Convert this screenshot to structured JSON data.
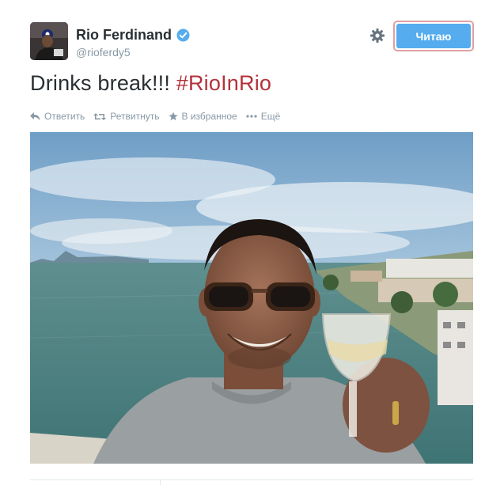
{
  "user": {
    "display_name": "Rio Ferdinand",
    "handle": "@rioferdy5",
    "verified": true
  },
  "follow_button": {
    "label": "Читаю"
  },
  "tweet": {
    "text": "Drinks break!!!",
    "hashtag": "#RioInRio"
  },
  "actions": [
    {
      "label": "Ответить",
      "icon": "reply-icon"
    },
    {
      "label": "Ретвитнуть",
      "icon": "retweet-icon"
    },
    {
      "label": "В избранное",
      "icon": "star-icon"
    },
    {
      "label": "Ещё",
      "icon": "more-icon"
    }
  ],
  "colors": {
    "accent": "#55acee",
    "hashtag": "#b3323a",
    "muted": "#8899a6",
    "text": "#292f33"
  }
}
